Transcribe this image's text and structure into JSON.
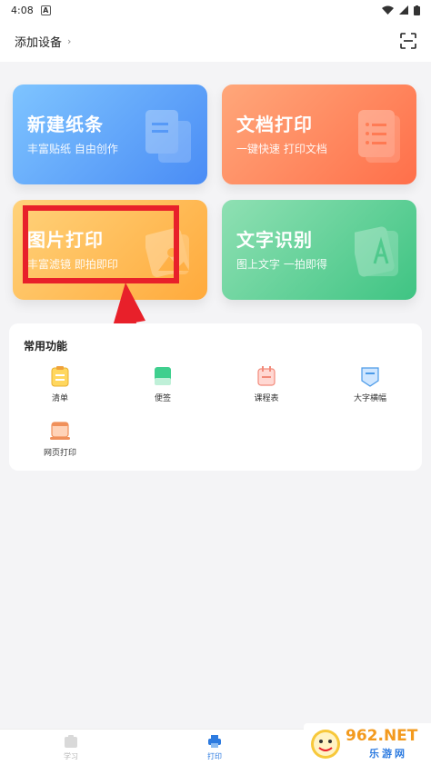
{
  "status_bar": {
    "time": "4:08",
    "app_badge": "A"
  },
  "header": {
    "add_device_label": "添加设备",
    "chevron": "›"
  },
  "cards": [
    {
      "title": "新建纸条",
      "subtitle": "丰富贴纸 自由创作",
      "icon": "document-stack-icon",
      "color": "#4a8cf5"
    },
    {
      "title": "文档打印",
      "subtitle": "一键快速 打印文档",
      "icon": "document-list-icon",
      "color": "#ff6f4a"
    },
    {
      "title": "图片打印",
      "subtitle": "丰富滤镜 即拍即印",
      "icon": "photo-icon",
      "color": "#ffaa3c"
    },
    {
      "title": "文字识别",
      "subtitle": "图上文字 一拍即得",
      "icon": "text-a-icon",
      "color": "#3fc483"
    }
  ],
  "functions": {
    "title": "常用功能",
    "items": [
      {
        "label": "清单",
        "icon": "checklist-icon"
      },
      {
        "label": "便签",
        "icon": "sticky-note-icon"
      },
      {
        "label": "课程表",
        "icon": "timetable-icon"
      },
      {
        "label": "大字横幅",
        "icon": "banner-icon"
      },
      {
        "label": "网页打印",
        "icon": "web-print-icon"
      }
    ]
  },
  "tabs": [
    {
      "label": "学习",
      "icon": "study-icon",
      "active": false
    },
    {
      "label": "打印",
      "icon": "printer-icon",
      "active": true
    }
  ],
  "watermark": {
    "logo_text": "962.NET",
    "sub_text": "乐游网"
  },
  "colors": {
    "accent": "#2d7be0",
    "annotation": "#e8202a"
  }
}
